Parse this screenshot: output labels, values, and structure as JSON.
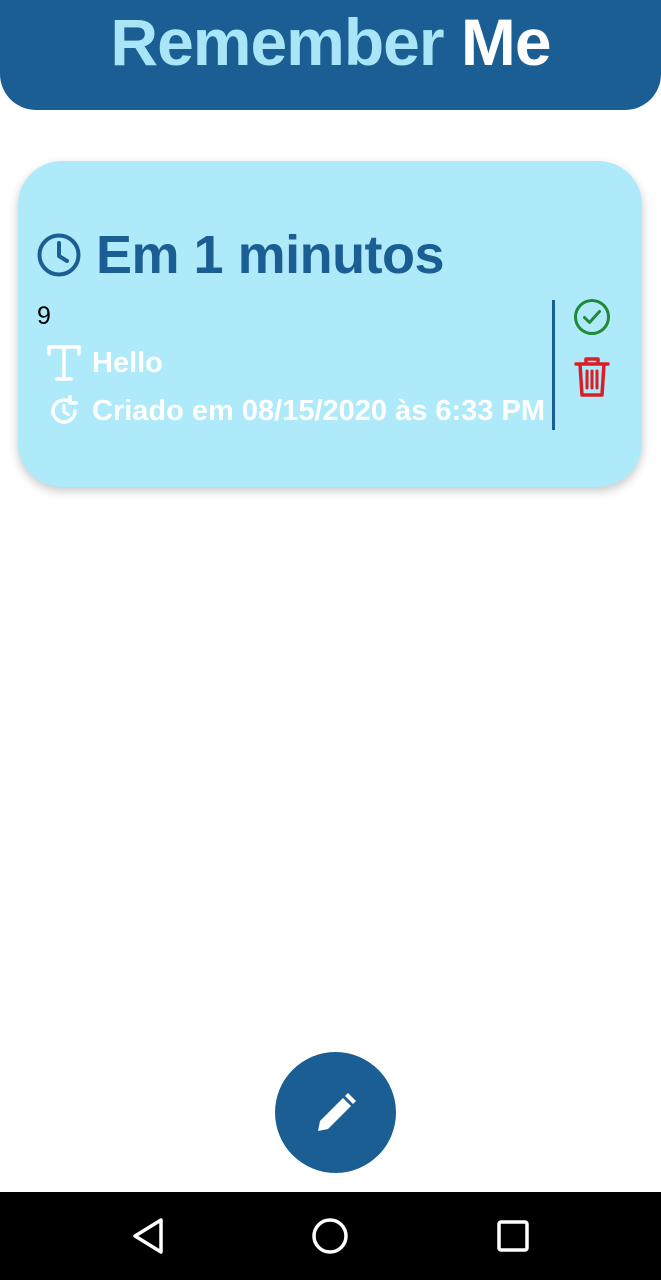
{
  "header": {
    "title_part1": "Remember",
    "title_part2": "Me"
  },
  "reminder": {
    "heading": "Em 1 minutos",
    "number": "9",
    "title": "Hello",
    "created": "Criado em 08/15/2020 às 6:33 PM"
  },
  "icons": {
    "heading": "clock-icon",
    "title": "text-icon",
    "created": "history-icon",
    "done": "check-circle-icon",
    "delete": "trash-icon",
    "fab": "pencil-icon",
    "nav_back": "back-triangle-icon",
    "nav_home": "home-circle-icon",
    "nav_recent": "recent-square-icon"
  },
  "colors": {
    "primary": "#1b5e94",
    "title_accent": "#a8e6f7",
    "card_background": "#aeeaf9",
    "done": "#1f8a3a",
    "delete": "#d81f26"
  }
}
